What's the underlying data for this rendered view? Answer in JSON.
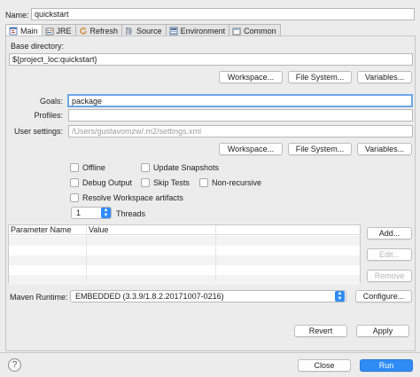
{
  "name": {
    "label": "Name:",
    "value": "quickstart"
  },
  "tabs": [
    {
      "label": "Main",
      "icon": "maven-main-icon",
      "active": true
    },
    {
      "label": "JRE",
      "icon": "jre-icon"
    },
    {
      "label": "Refresh",
      "icon": "refresh-icon"
    },
    {
      "label": "Source",
      "icon": "source-icon"
    },
    {
      "label": "Environment",
      "icon": "environment-icon"
    },
    {
      "label": "Common",
      "icon": "common-icon"
    }
  ],
  "base_directory": {
    "label": "Base directory:",
    "value": "${project_loc:quickstart}",
    "buttons": {
      "workspace": "Workspace...",
      "file_system": "File System...",
      "variables": "Variables..."
    }
  },
  "goals": {
    "label": "Goals:",
    "value": "package"
  },
  "profiles": {
    "label": "Profiles:",
    "value": ""
  },
  "user_settings": {
    "label": "User settings:",
    "placeholder": "/Users/gustavomzw/.m2/settings.xml",
    "buttons": {
      "workspace": "Workspace...",
      "file_system": "File System...",
      "variables": "Variables..."
    }
  },
  "options": {
    "offline": "Offline",
    "update_snapshots": "Update Snapshots",
    "debug_output": "Debug Output",
    "skip_tests": "Skip Tests",
    "non_recursive": "Non-recursive",
    "resolve_workspace": "Resolve Workspace artifacts"
  },
  "threads": {
    "value": "1",
    "label": "Threads"
  },
  "parameters": {
    "columns": [
      "Parameter Name",
      "Value"
    ],
    "rows": [],
    "buttons": {
      "add": "Add...",
      "edit": "Edit...",
      "remove": "Remove"
    }
  },
  "maven_runtime": {
    "label": "Maven Runtime:",
    "value": "EMBEDDED (3.3.9/1.8.2.20171007-0216)",
    "configure": "Configure..."
  },
  "footer": {
    "revert": "Revert",
    "apply": "Apply",
    "close": "Close",
    "run": "Run",
    "help": "?"
  },
  "colors": {
    "accent": "#2f8cf7",
    "focus": "#6ea7e6"
  }
}
